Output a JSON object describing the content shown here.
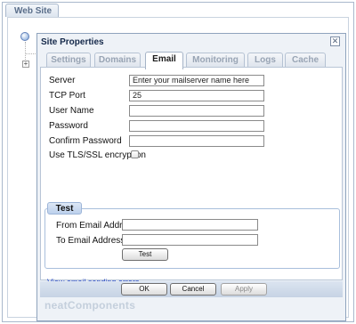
{
  "outer": {
    "tab_label": "Web Site"
  },
  "dialog": {
    "title": "Site Properties",
    "close_glyph": "✕",
    "tabs": [
      {
        "label": "Settings",
        "active": false
      },
      {
        "label": "Domains",
        "active": false
      },
      {
        "label": "Email",
        "active": true
      },
      {
        "label": "Monitoring",
        "active": false
      },
      {
        "label": "Logs",
        "active": false
      },
      {
        "label": "Cache",
        "active": false
      }
    ],
    "form": {
      "server_label": "Server",
      "server_value": "Enter your mailserver name here",
      "tcp_port_label": "TCP Port",
      "tcp_port_value": "25",
      "username_label": "User Name",
      "username_value": "",
      "password_label": "Password",
      "password_value": "",
      "confirm_password_label": "Confirm Password",
      "confirm_password_value": "",
      "tls_label": "Use TLS/SSL encryption",
      "tls_checked": false
    },
    "test": {
      "legend": "Test",
      "from_label": "From Email Address",
      "from_value": "",
      "to_label": "To Email Address",
      "to_value": "",
      "test_button": "Test"
    },
    "errors_link": "View email sending errors",
    "buttons": {
      "ok": "OK",
      "cancel": "Cancel",
      "apply": "Apply"
    },
    "brand": "neatComponents"
  },
  "colors": {
    "accent": "#1a3ec5",
    "dialog_bg": "#eef2f7",
    "border": "#8fa3bd"
  }
}
